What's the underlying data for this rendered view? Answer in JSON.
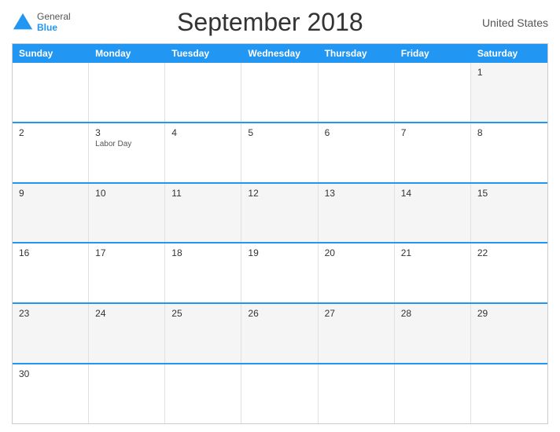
{
  "header": {
    "title": "September 2018",
    "country": "United States",
    "logo_general": "General",
    "logo_blue": "Blue"
  },
  "day_headers": [
    "Sunday",
    "Monday",
    "Tuesday",
    "Wednesday",
    "Thursday",
    "Friday",
    "Saturday"
  ],
  "weeks": [
    [
      {
        "date": "",
        "event": "",
        "empty": true
      },
      {
        "date": "",
        "event": "",
        "empty": true
      },
      {
        "date": "",
        "event": "",
        "empty": true
      },
      {
        "date": "",
        "event": "",
        "empty": true
      },
      {
        "date": "",
        "event": "",
        "empty": true
      },
      {
        "date": "",
        "event": "",
        "empty": true
      },
      {
        "date": "1",
        "event": ""
      }
    ],
    [
      {
        "date": "2",
        "event": ""
      },
      {
        "date": "3",
        "event": "Labor Day"
      },
      {
        "date": "4",
        "event": ""
      },
      {
        "date": "5",
        "event": ""
      },
      {
        "date": "6",
        "event": ""
      },
      {
        "date": "7",
        "event": ""
      },
      {
        "date": "8",
        "event": ""
      }
    ],
    [
      {
        "date": "9",
        "event": ""
      },
      {
        "date": "10",
        "event": ""
      },
      {
        "date": "11",
        "event": ""
      },
      {
        "date": "12",
        "event": ""
      },
      {
        "date": "13",
        "event": ""
      },
      {
        "date": "14",
        "event": ""
      },
      {
        "date": "15",
        "event": ""
      }
    ],
    [
      {
        "date": "16",
        "event": ""
      },
      {
        "date": "17",
        "event": ""
      },
      {
        "date": "18",
        "event": ""
      },
      {
        "date": "19",
        "event": ""
      },
      {
        "date": "20",
        "event": ""
      },
      {
        "date": "21",
        "event": ""
      },
      {
        "date": "22",
        "event": ""
      }
    ],
    [
      {
        "date": "23",
        "event": ""
      },
      {
        "date": "24",
        "event": ""
      },
      {
        "date": "25",
        "event": ""
      },
      {
        "date": "26",
        "event": ""
      },
      {
        "date": "27",
        "event": ""
      },
      {
        "date": "28",
        "event": ""
      },
      {
        "date": "29",
        "event": ""
      }
    ],
    [
      {
        "date": "30",
        "event": ""
      },
      {
        "date": "",
        "event": "",
        "empty": true
      },
      {
        "date": "",
        "event": "",
        "empty": true
      },
      {
        "date": "",
        "event": "",
        "empty": true
      },
      {
        "date": "",
        "event": "",
        "empty": true
      },
      {
        "date": "",
        "event": "",
        "empty": true
      },
      {
        "date": "",
        "event": "",
        "empty": true
      }
    ]
  ],
  "colors": {
    "header_bg": "#2196F3",
    "accent": "#2196F3"
  }
}
